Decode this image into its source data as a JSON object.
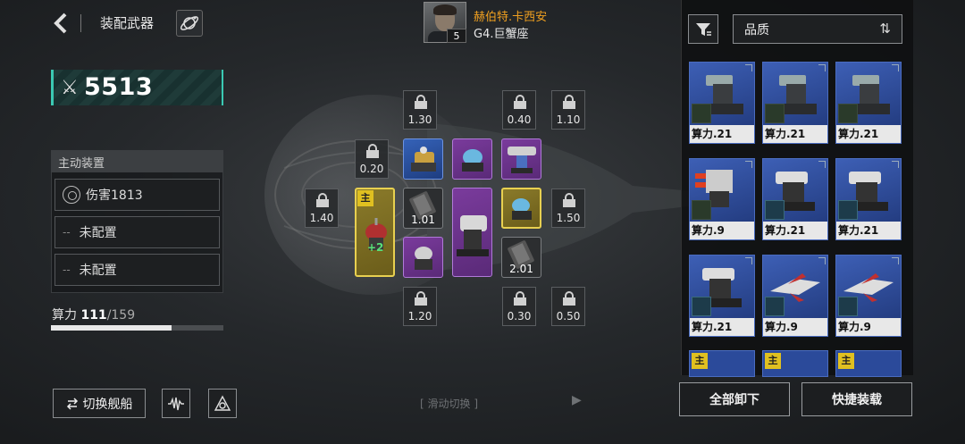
{
  "header": {
    "title": "装配武器",
    "back_icon": "chevron-left-icon",
    "planet_icon": "planet-icon"
  },
  "power": {
    "value": "5513",
    "icon": "crossed-swords-icon"
  },
  "active_devices": {
    "header": "主动装置",
    "slots": [
      {
        "dash": "",
        "label": "伤害1813",
        "icon": "gear-icon"
      },
      {
        "dash": "--",
        "label": "未配置"
      },
      {
        "dash": "--",
        "label": "未配置"
      }
    ]
  },
  "compute": {
    "label": "算力",
    "current": "111",
    "max": "/159",
    "fraction": 0.698
  },
  "bottom_left": {
    "switch_label": "切换舰船",
    "switch_icon": "swap-arrows-icon",
    "btn2_icon": "waveform-icon",
    "btn3_icon": "fleet-formation-icon"
  },
  "swipe_hint": "滑动切换",
  "pilot": {
    "name": "赫伯特.卡西安",
    "subtitle": "G4.巨蟹座",
    "level": "5"
  },
  "grid": {
    "locks": [
      {
        "cost": "1.30"
      },
      {
        "cost": "0.40"
      },
      {
        "cost": "1.10"
      },
      {
        "cost": "0.20"
      },
      {
        "cost": "1.40"
      },
      {
        "cost": "1.50"
      },
      {
        "cost": "1.20"
      },
      {
        "cost": "0.30"
      },
      {
        "cost": "0.50"
      }
    ],
    "modules": [
      {
        "num": "1.01"
      },
      {
        "num": "2.01"
      }
    ],
    "main_tag": "主",
    "plus_label": "+2"
  },
  "right_panel": {
    "filter_icon": "filter-icon",
    "sort_label": "品质",
    "sort_icon": "sort-arrows-icon",
    "cards": [
      {
        "label": "算力.21"
      },
      {
        "label": "算力.21"
      },
      {
        "label": "算力.21"
      },
      {
        "label": "算力.9"
      },
      {
        "label": "算力.21"
      },
      {
        "label": "算力.21"
      },
      {
        "label": "算力.21"
      },
      {
        "label": "算力.9"
      },
      {
        "label": "算力.9"
      }
    ],
    "partial_tag": "主",
    "unequip_all": "全部卸下",
    "quick_equip": "快捷装载"
  },
  "colors": {
    "accent_teal": "#3bc9b3",
    "pilot_name": "#f0a020",
    "card_blue": "#2b4a9a",
    "module_purple": "#7a3b9c",
    "module_gold": "#e8d050"
  }
}
